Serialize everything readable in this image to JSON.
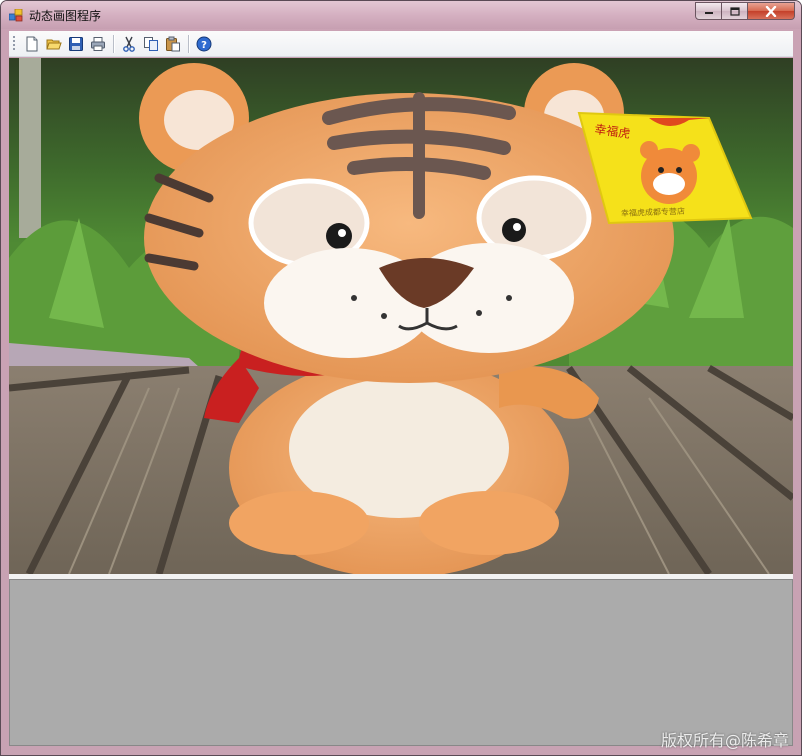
{
  "window": {
    "title": "动态画图程序",
    "icons": {
      "app": "app-icon",
      "minimize": "minimize-icon",
      "maximize": "maximize-icon",
      "close": "close-icon"
    }
  },
  "toolbar": {
    "items": [
      {
        "name": "new",
        "icon": "new-file-icon"
      },
      {
        "name": "open",
        "icon": "open-folder-icon"
      },
      {
        "name": "save",
        "icon": "save-icon"
      },
      {
        "name": "print",
        "icon": "print-icon"
      },
      {
        "name": "cut",
        "icon": "cut-icon"
      },
      {
        "name": "copy",
        "icon": "copy-icon"
      },
      {
        "name": "paste",
        "icon": "paste-icon"
      },
      {
        "name": "help",
        "icon": "help-icon"
      }
    ]
  },
  "canvas": {
    "image": "plush-tiger-photo",
    "tag_text": "幸福虎",
    "tag_footer": "幸福虎成都专营店"
  },
  "watermark": "版权所有@陈希章",
  "colors": {
    "title_bar": "#d5b0c1",
    "panel": "#ababab",
    "close_button": "#c4402a"
  }
}
